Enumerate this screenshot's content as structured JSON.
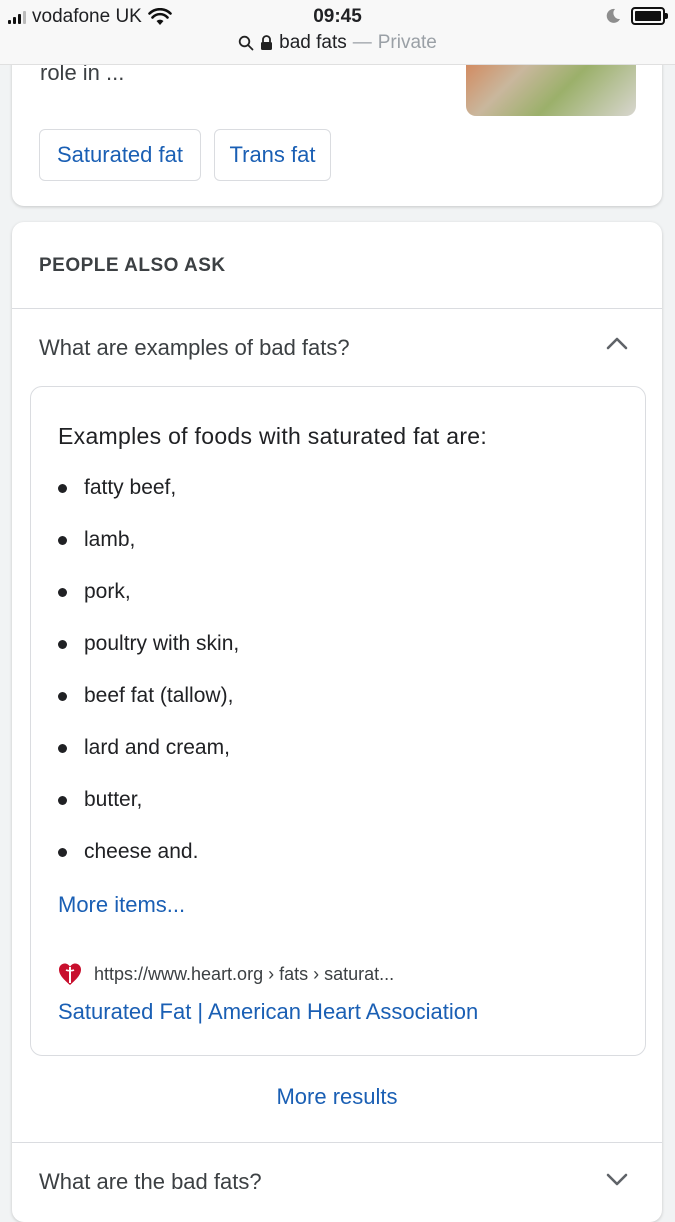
{
  "status_bar": {
    "carrier": "vodafone UK",
    "time": "09:45",
    "url_query": "bad fats",
    "url_separator": "—",
    "url_mode": "Private"
  },
  "top_card": {
    "snippet_tail": "role in ...",
    "chips": [
      "Saturated fat",
      "Trans fat"
    ]
  },
  "paa": {
    "heading": "PEOPLE ALSO ASK",
    "question_1": "What are examples of bad fats?",
    "answer": {
      "title": "Examples of foods with saturated fat are:",
      "items": [
        "fatty beef,",
        "lamb,",
        "pork,",
        "poultry with skin,",
        "beef fat (tallow),",
        "lard and cream,",
        "butter,",
        "cheese and."
      ],
      "more_items": "More items...",
      "source_url": "https://www.heart.org › fats › saturat...",
      "source_title": "Saturated Fat | American Heart Association"
    },
    "more_results": "More results",
    "question_2": "What are the bad fats?"
  },
  "colors": {
    "link": "#1a5fb4",
    "text": "#202124",
    "heart_logo": "#c8102e"
  }
}
